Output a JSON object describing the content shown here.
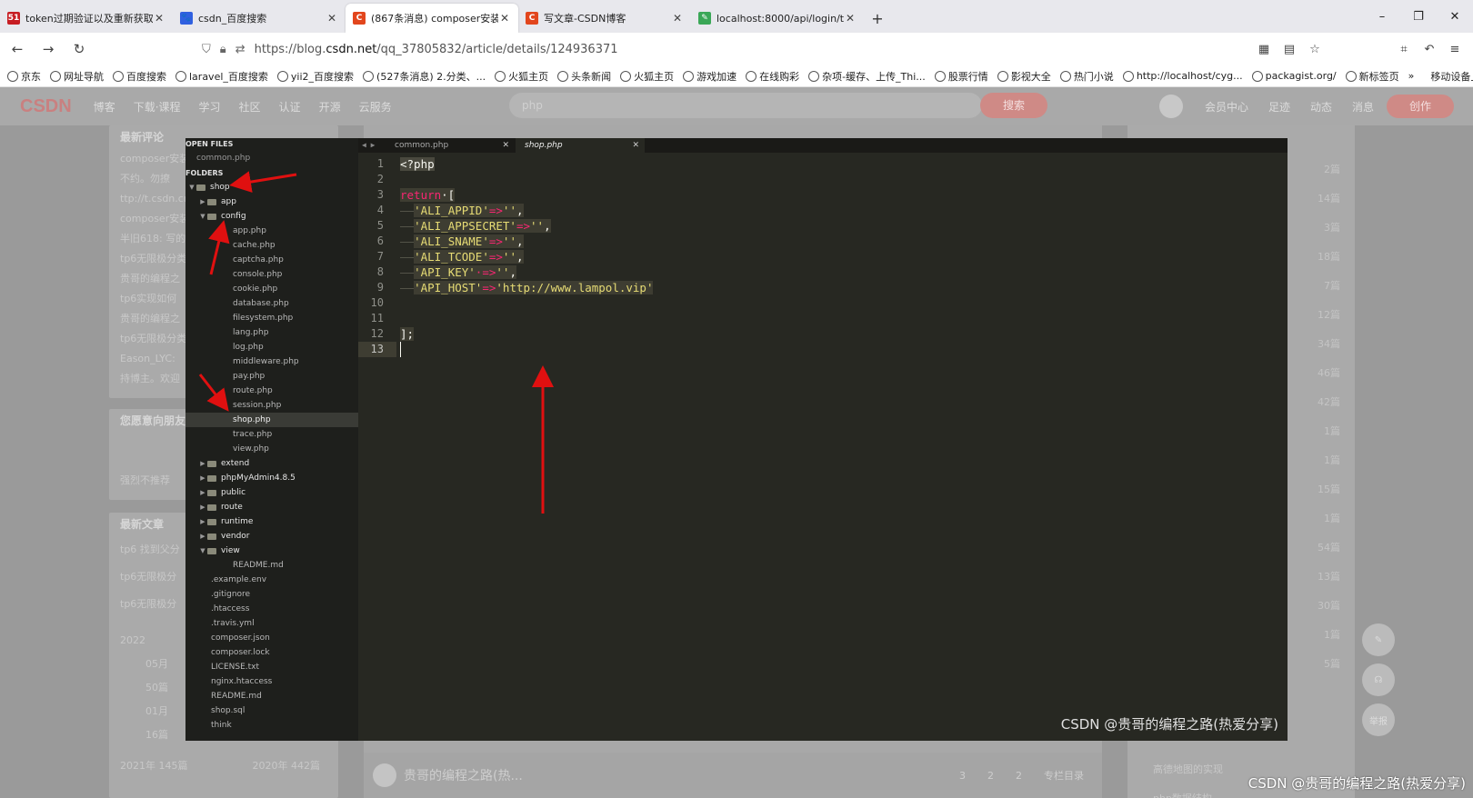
{
  "browser": {
    "tabs": [
      {
        "label": "token过期验证以及重新获取处",
        "fav": "51",
        "color": "#c71d23",
        "active": false
      },
      {
        "label": "csdn_百度搜索",
        "fav": "🐾",
        "color": "#3060e0",
        "active": false
      },
      {
        "label": "(867条消息) composer安装JW",
        "fav": "C",
        "color": "#e2461d",
        "active": true
      },
      {
        "label": "写文章-CSDN博客",
        "fav": "C",
        "color": "#e2461d",
        "active": false
      },
      {
        "label": "localhost:8000/api/login/tok",
        "fav": "✎",
        "color": "#3aa757",
        "active": false
      }
    ],
    "new_tab": "+",
    "url_prefix": "https://blog.",
    "url_host": "csdn.net",
    "url_path": "/qq_37805832/article/details/124936371",
    "bookmarks": [
      "京东",
      "网址导航",
      "百度搜索",
      "laravel_百度搜索",
      "yii2_百度搜索",
      "(527条消息) 2.分类、...",
      "火狐主页",
      "头条新闻",
      "火狐主页",
      "游戏加速",
      "在线购彩",
      "杂项-缓存、上传_Thi...",
      "股票行情",
      "影视大全",
      "热门小说",
      "http://localhost/cyg...",
      "packagist.org/",
      "新标签页"
    ],
    "bookmarks_more": "»",
    "mobile_bookmarks": "移动设备上的书签"
  },
  "csdn": {
    "logo": "CSDN",
    "nav": [
      "博客",
      "下载·课程",
      "学习",
      "社区",
      "认证",
      "开源",
      "云服务"
    ],
    "search_placeholder": "php",
    "search_btn": "搜索",
    "right_nav": [
      "会员中心",
      "足迹",
      "动态",
      "消息"
    ],
    "create_btn": "创作",
    "left_card1": {
      "title": "最新评论",
      "lines": [
        "composer安装",
        "不约。勿撩",
        "ttp://t.csdn.cn",
        "composer安装",
        "半旧618: 写的",
        "tp6无限极分类",
        "贵哥的编程之",
        "tp6实现如何",
        "贵哥的编程之",
        "tp6无限极分类",
        "Eason_LYC:",
        "持博主。欢迎"
      ]
    },
    "left_card2": {
      "title": "您愿意向朋友",
      "lines": [
        "强烈不推荐"
      ]
    },
    "left_card3": {
      "title": "最新文章",
      "lines": [
        "tp6 找到父分",
        "tp6无限极分",
        "tp6无限极分"
      ]
    },
    "archive": {
      "year": "2022",
      "m1": "05月",
      "c1": "50篇",
      "m2": "01月",
      "c2": "16篇",
      "y21": "2021年 145篇",
      "y20": "2020年 442篇"
    },
    "author": "贵哥的编程之路(热...",
    "footer_actions": [
      "3",
      "2",
      "2",
      "专栏目录"
    ],
    "right_counts": [
      "2篇",
      "14篇",
      "3篇",
      "18篇",
      "7篇",
      "12篇",
      "34篇",
      "46篇",
      "42篇",
      "1篇",
      "1篇",
      "15篇",
      "1篇",
      "54篇",
      "13篇",
      "30篇",
      "1篇",
      "5篇"
    ],
    "right_links": [
      "高德地图的实现",
      "php数据结构..."
    ],
    "float_btns": [
      "✎",
      "☊",
      "举报"
    ],
    "watermark": "CSDN @贵哥的编程之路(热爱分享)"
  },
  "editor": {
    "open_files_label": "OPEN FILES",
    "open_files": [
      "common.php"
    ],
    "folders_label": "FOLDERS",
    "tree": [
      {
        "name": "shop",
        "depth": 0,
        "type": "dir",
        "open": true
      },
      {
        "name": "app",
        "depth": 1,
        "type": "dir",
        "open": false
      },
      {
        "name": "config",
        "depth": 1,
        "type": "dir",
        "open": true
      },
      {
        "name": "app.php",
        "depth": 2,
        "type": "file"
      },
      {
        "name": "cache.php",
        "depth": 2,
        "type": "file"
      },
      {
        "name": "captcha.php",
        "depth": 2,
        "type": "file"
      },
      {
        "name": "console.php",
        "depth": 2,
        "type": "file"
      },
      {
        "name": "cookie.php",
        "depth": 2,
        "type": "file"
      },
      {
        "name": "database.php",
        "depth": 2,
        "type": "file"
      },
      {
        "name": "filesystem.php",
        "depth": 2,
        "type": "file"
      },
      {
        "name": "lang.php",
        "depth": 2,
        "type": "file"
      },
      {
        "name": "log.php",
        "depth": 2,
        "type": "file"
      },
      {
        "name": "middleware.php",
        "depth": 2,
        "type": "file"
      },
      {
        "name": "pay.php",
        "depth": 2,
        "type": "file"
      },
      {
        "name": "route.php",
        "depth": 2,
        "type": "file"
      },
      {
        "name": "session.php",
        "depth": 2,
        "type": "file"
      },
      {
        "name": "shop.php",
        "depth": 2,
        "type": "file",
        "selected": true
      },
      {
        "name": "trace.php",
        "depth": 2,
        "type": "file"
      },
      {
        "name": "view.php",
        "depth": 2,
        "type": "file"
      },
      {
        "name": "extend",
        "depth": 1,
        "type": "dir",
        "open": false
      },
      {
        "name": "phpMyAdmin4.8.5",
        "depth": 1,
        "type": "dir",
        "open": false
      },
      {
        "name": "public",
        "depth": 1,
        "type": "dir",
        "open": false
      },
      {
        "name": "route",
        "depth": 1,
        "type": "dir",
        "open": false
      },
      {
        "name": "runtime",
        "depth": 1,
        "type": "dir",
        "open": false
      },
      {
        "name": "vendor",
        "depth": 1,
        "type": "dir",
        "open": false
      },
      {
        "name": "view",
        "depth": 1,
        "type": "dir",
        "open": true
      },
      {
        "name": "README.md",
        "depth": 2,
        "type": "file"
      },
      {
        "name": ".example.env",
        "depth": 1,
        "type": "file"
      },
      {
        "name": ".gitignore",
        "depth": 1,
        "type": "file"
      },
      {
        "name": ".htaccess",
        "depth": 1,
        "type": "file"
      },
      {
        "name": ".travis.yml",
        "depth": 1,
        "type": "file"
      },
      {
        "name": "composer.json",
        "depth": 1,
        "type": "file"
      },
      {
        "name": "composer.lock",
        "depth": 1,
        "type": "file"
      },
      {
        "name": "LICENSE.txt",
        "depth": 1,
        "type": "file"
      },
      {
        "name": "nginx.htaccess",
        "depth": 1,
        "type": "file"
      },
      {
        "name": "README.md",
        "depth": 1,
        "type": "file"
      },
      {
        "name": "shop.sql",
        "depth": 1,
        "type": "file"
      },
      {
        "name": "think",
        "depth": 1,
        "type": "file"
      }
    ],
    "tabs": [
      {
        "label": "common.php",
        "active": false
      },
      {
        "label": "shop.php",
        "active": true
      }
    ],
    "current_line": 13,
    "lines": [
      [
        {
          "t": "<?php",
          "c": "hl"
        }
      ],
      [],
      [
        {
          "t": "return",
          "c": "kw"
        },
        {
          "t": "·[",
          "c": ""
        }
      ],
      [
        {
          "t": "——",
          "c": "ind"
        },
        {
          "t": "'ALI_APPID'",
          "c": "str"
        },
        {
          "t": "=>",
          "c": "op"
        },
        {
          "t": "''",
          "c": "str"
        },
        {
          "t": ",",
          "c": ""
        }
      ],
      [
        {
          "t": "——",
          "c": "ind"
        },
        {
          "t": "'ALI_APPSECRET'",
          "c": "str"
        },
        {
          "t": "=>",
          "c": "op"
        },
        {
          "t": "''",
          "c": "str"
        },
        {
          "t": ",",
          "c": ""
        }
      ],
      [
        {
          "t": "——",
          "c": "ind"
        },
        {
          "t": "'ALI_SNAME'",
          "c": "str"
        },
        {
          "t": "=>",
          "c": "op"
        },
        {
          "t": "''",
          "c": "str"
        },
        {
          "t": ",",
          "c": ""
        }
      ],
      [
        {
          "t": "——",
          "c": "ind"
        },
        {
          "t": "'ALI_TCODE'",
          "c": "str"
        },
        {
          "t": "=>",
          "c": "op"
        },
        {
          "t": "''",
          "c": "str"
        },
        {
          "t": ",",
          "c": ""
        }
      ],
      [
        {
          "t": "——",
          "c": "ind"
        },
        {
          "t": "'API_KEY'",
          "c": "str"
        },
        {
          "t": "·=>",
          "c": "op"
        },
        {
          "t": "''",
          "c": "str"
        },
        {
          "t": ",",
          "c": ""
        }
      ],
      [
        {
          "t": "——",
          "c": "ind"
        },
        {
          "t": "'API_HOST'",
          "c": "str"
        },
        {
          "t": "=>",
          "c": "op"
        },
        {
          "t": "'http://www.lampol.vip'",
          "c": "str"
        }
      ],
      [],
      [],
      [
        {
          "t": "];",
          "c": ""
        }
      ],
      []
    ],
    "watermark": "CSDN @贵哥的编程之路(热爱分享)"
  }
}
